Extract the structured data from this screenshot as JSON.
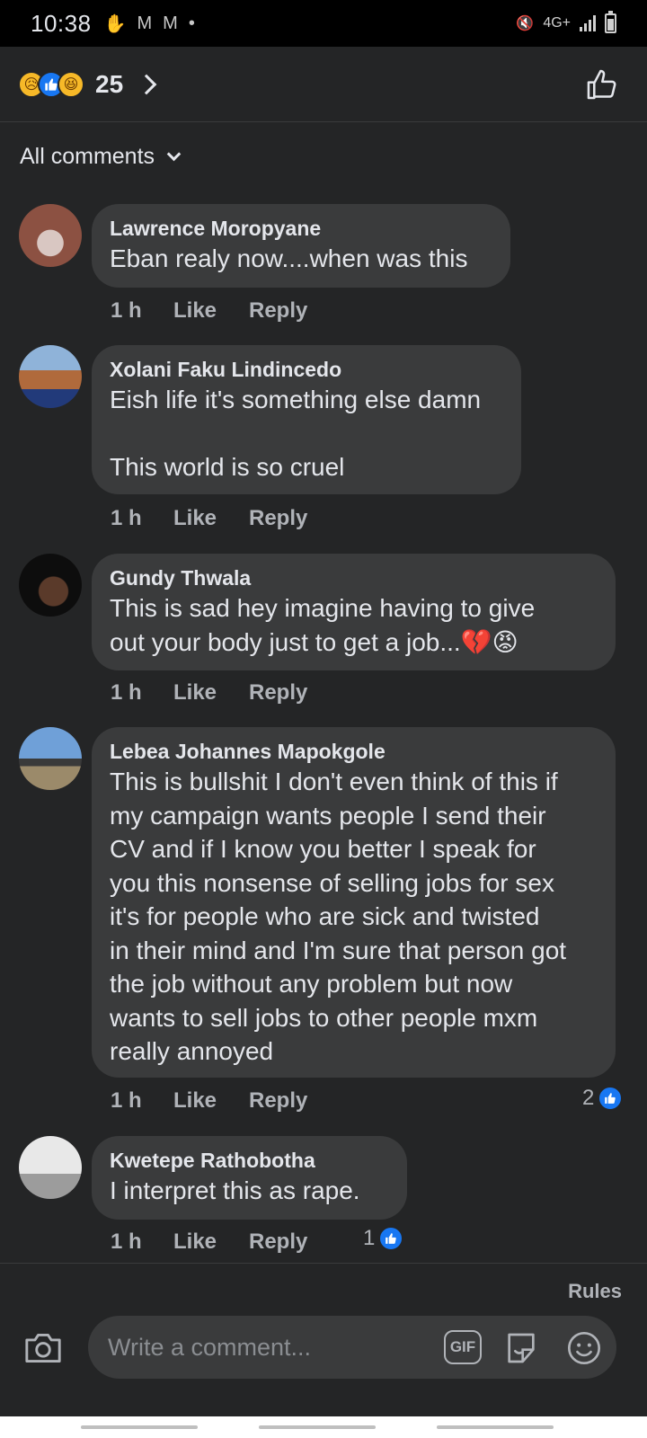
{
  "status_bar": {
    "time": "10:38",
    "network": "4G+"
  },
  "header": {
    "reactions": [
      "sad",
      "like",
      "haha"
    ],
    "reaction_count": "25"
  },
  "sort_label": "All comments",
  "comments": [
    {
      "name": "Lawrence Moropyane",
      "text": "Eban realy now....when was this",
      "time": "1 h",
      "like": "Like",
      "reply": "Reply",
      "likes": ""
    },
    {
      "name": "Xolani Faku Lindincedo",
      "text": "Eish life it's something else damn\n\nThis world is so cruel",
      "time": "1 h",
      "like": "Like",
      "reply": "Reply",
      "likes": ""
    },
    {
      "name": "Gundy Thwala",
      "text": "This is sad hey imagine having to give\nout your body just to get a job...",
      "time": "1 h",
      "like": "Like",
      "reply": "Reply",
      "likes": "",
      "emoji": "💔😡"
    },
    {
      "name": "Lebea Johannes Mapokgole",
      "text": "This is bullshit I don't even think of this if\nmy campaign wants people I send their\nCV and if I know you better I speak for\nyou this nonsense of selling jobs for sex\nit's for people who are sick and twisted\nin their mind and I'm sure that person got\nthe job without any problem but now\nwants to sell jobs to other people mxm\nreally annoyed",
      "time": "1 h",
      "like": "Like",
      "reply": "Reply",
      "likes": "2"
    },
    {
      "name": "Kwetepe Rathobotha",
      "text": "I interpret this as rape.",
      "time": "1 h",
      "like": "Like",
      "reply": "Reply",
      "likes": "1"
    }
  ],
  "composer": {
    "rules_label": "Rules",
    "placeholder": "Write a comment...",
    "gif_label": "GIF"
  }
}
